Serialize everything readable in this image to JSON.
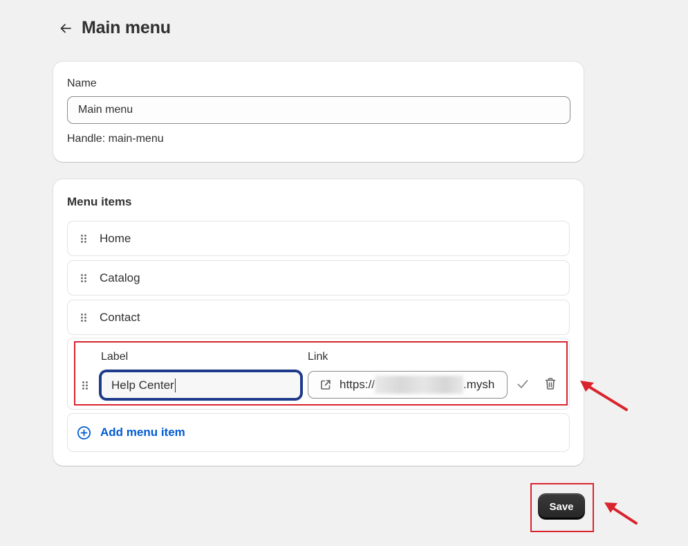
{
  "header": {
    "title": "Main menu",
    "back_icon": "arrow-left-icon"
  },
  "name_card": {
    "name_label": "Name",
    "name_value": "Main menu",
    "handle_text": "Handle: main-menu"
  },
  "menu_card": {
    "title": "Menu items",
    "items": [
      {
        "label": "Home"
      },
      {
        "label": "Catalog"
      },
      {
        "label": "Contact"
      }
    ],
    "edit_item": {
      "label_title": "Label",
      "label_value": "Help Center",
      "link_title": "Link",
      "link_prefix": "https://",
      "link_suffix": ".mysh"
    },
    "add_label": "Add menu item"
  },
  "actions": {
    "save_label": "Save"
  },
  "colors": {
    "background": "#f1f1f1",
    "accent_link": "#005bd3",
    "annotation_red": "#d9232d",
    "save_button": "#303030"
  }
}
